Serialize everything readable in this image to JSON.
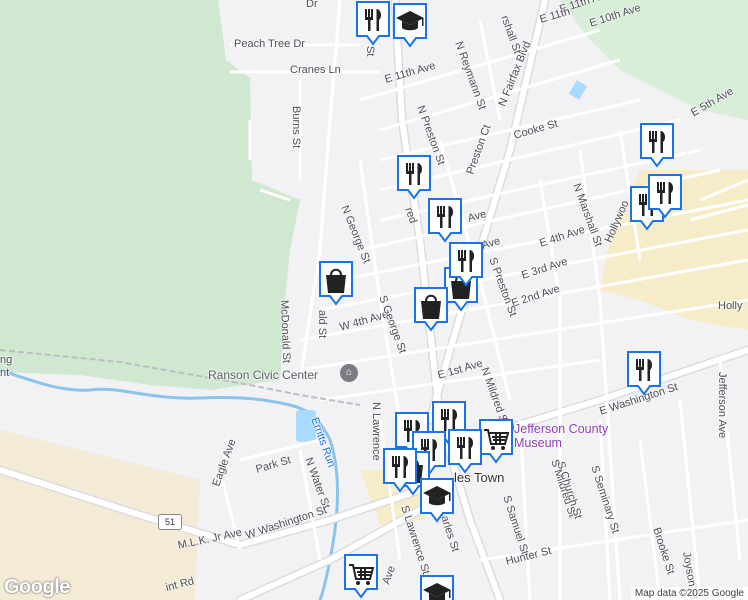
{
  "map": {
    "colors": {
      "background": "#f2f1f4",
      "park": "#cfe8cf",
      "industrial": "#f6edc8",
      "water": "#aadaff",
      "river": "#8ac4ea",
      "road": "#ffffff",
      "road_outline": "#dcdce0",
      "marker_fill": "#1a73e8",
      "museum_text": "#8e3fb7"
    },
    "street_labels": [
      {
        "id": "peach-tree-dr",
        "text": "Peach Tree Dr"
      },
      {
        "id": "cranes-ln",
        "text": "Cranes Ln"
      },
      {
        "id": "burns-st",
        "text": "Burns St"
      },
      {
        "id": "e-11th-ave-a",
        "text": "E 11th Ave"
      },
      {
        "id": "e-11th-ave-b",
        "text": "E 11th Ave"
      },
      {
        "id": "e-10th-ave",
        "text": "E 10th Ave"
      },
      {
        "id": "n-reymann-st",
        "text": "N Reymann St"
      },
      {
        "id": "n-fairfax-blvd",
        "text": "N Fairfax Blvd"
      },
      {
        "id": "n-preston-st",
        "text": "N Preston St"
      },
      {
        "id": "preston-ct",
        "text": "Preston Ct"
      },
      {
        "id": "cooke-st",
        "text": "Cooke St"
      },
      {
        "id": "e-5th-ave",
        "text": "E 5th Ave"
      },
      {
        "id": "n-marshall-st",
        "text": "N Marshall St"
      },
      {
        "id": "n-george-st",
        "text": "N George St"
      },
      {
        "id": "e-4th-ave",
        "text": "E 4th Ave"
      },
      {
        "id": "e-3rd-ave",
        "text": "E 3rd Ave"
      },
      {
        "id": "e-2nd-ave",
        "text": "E 2nd Ave"
      },
      {
        "id": "s-preston-st",
        "text": "S Preston St"
      },
      {
        "id": "hollywood",
        "text": "Hollywoo"
      },
      {
        "id": "holly",
        "text": "Holly"
      },
      {
        "id": "mcdonald-st",
        "text": "McDonald St"
      },
      {
        "id": "w-4th-ave",
        "text": "W 4th Ave"
      },
      {
        "id": "s-george-st",
        "text": "S George St"
      },
      {
        "id": "e-1st-ave",
        "text": "E 1st Ave"
      },
      {
        "id": "n-mildred-st",
        "text": "N Mildred St"
      },
      {
        "id": "e-washington-st",
        "text": "E Washington St"
      },
      {
        "id": "jefferson-ave",
        "text": "Jefferson Ave"
      },
      {
        "id": "n-lawrence",
        "text": "N Lawrence"
      },
      {
        "id": "erritts-run",
        "text": "Erritts Run"
      },
      {
        "id": "park-st",
        "text": "Park St"
      },
      {
        "id": "n-water-st",
        "text": "N Water St"
      },
      {
        "id": "eagle-ave",
        "text": "Eagle Ave"
      },
      {
        "id": "w-washington-st",
        "text": "W Washington St"
      },
      {
        "id": "mlk-jr-ave",
        "text": "M.L.K. Jr Ave"
      },
      {
        "id": "s-lawrence-st",
        "text": "S Lawrence St"
      },
      {
        "id": "s-charles-st",
        "text": "arles St"
      },
      {
        "id": "s-samuel-st",
        "text": "S Samuel St"
      },
      {
        "id": "s-mildred-st",
        "text": "S Mildred St"
      },
      {
        "id": "s-church-st",
        "text": "S Church St"
      },
      {
        "id": "s-seminary-st",
        "text": "S Seminary St"
      },
      {
        "id": "brooke-st",
        "text": "Brooke St"
      },
      {
        "id": "hunter-st",
        "text": "Hunter St"
      },
      {
        "id": "joyson-st",
        "text": "Joyson St"
      },
      {
        "id": "saint-rd",
        "text": "int Rd"
      },
      {
        "id": "ave-bottom",
        "text": "Ave"
      },
      {
        "id": "ng-left",
        "text": "ng"
      },
      {
        "id": "nt-left",
        "text": "nt"
      },
      {
        "id": "dr-top",
        "text": "Dr"
      },
      {
        "id": "st-top",
        "text": "St"
      },
      {
        "id": "rshall-st",
        "text": "rshall St"
      },
      {
        "id": "e-11th-ave-c",
        "text": "E 11th"
      },
      {
        "id": "ave-mid",
        "text": "Ave"
      },
      {
        "id": "ave-mid2",
        "text": "Ave"
      },
      {
        "id": "red",
        "text": "red"
      },
      {
        "id": "ald-st",
        "text": "ald St"
      }
    ],
    "poi_labels": [
      {
        "id": "ranson-civic-center",
        "text": "Ranson Civic Center"
      },
      {
        "id": "jefferson-county-museum",
        "text": "Jefferson County Museum"
      },
      {
        "id": "charles-town",
        "text": "les Town"
      }
    ],
    "route_shield": "51",
    "markers": [
      {
        "id": "m1",
        "type": "restaurant"
      },
      {
        "id": "m2",
        "type": "school"
      },
      {
        "id": "m3",
        "type": "restaurant"
      },
      {
        "id": "m4",
        "type": "restaurant"
      },
      {
        "id": "m5",
        "type": "restaurant"
      },
      {
        "id": "m6",
        "type": "restaurant"
      },
      {
        "id": "m7",
        "type": "restaurant"
      },
      {
        "id": "m8",
        "type": "shopping"
      },
      {
        "id": "m9",
        "type": "shopping"
      },
      {
        "id": "m10",
        "type": "shopping"
      },
      {
        "id": "m11",
        "type": "restaurant"
      },
      {
        "id": "m12",
        "type": "restaurant"
      },
      {
        "id": "m13",
        "type": "grocery"
      },
      {
        "id": "m14",
        "type": "restaurant"
      },
      {
        "id": "m15",
        "type": "restaurant"
      },
      {
        "id": "m16",
        "type": "restaurant"
      },
      {
        "id": "m17",
        "type": "restaurant"
      },
      {
        "id": "m18",
        "type": "shopping"
      },
      {
        "id": "m19",
        "type": "school"
      },
      {
        "id": "m20",
        "type": "grocery"
      },
      {
        "id": "m21",
        "type": "school"
      },
      {
        "id": "m22",
        "type": "restaurant"
      }
    ],
    "logo": "Google",
    "attribution": "Map data ©2025 Google"
  }
}
